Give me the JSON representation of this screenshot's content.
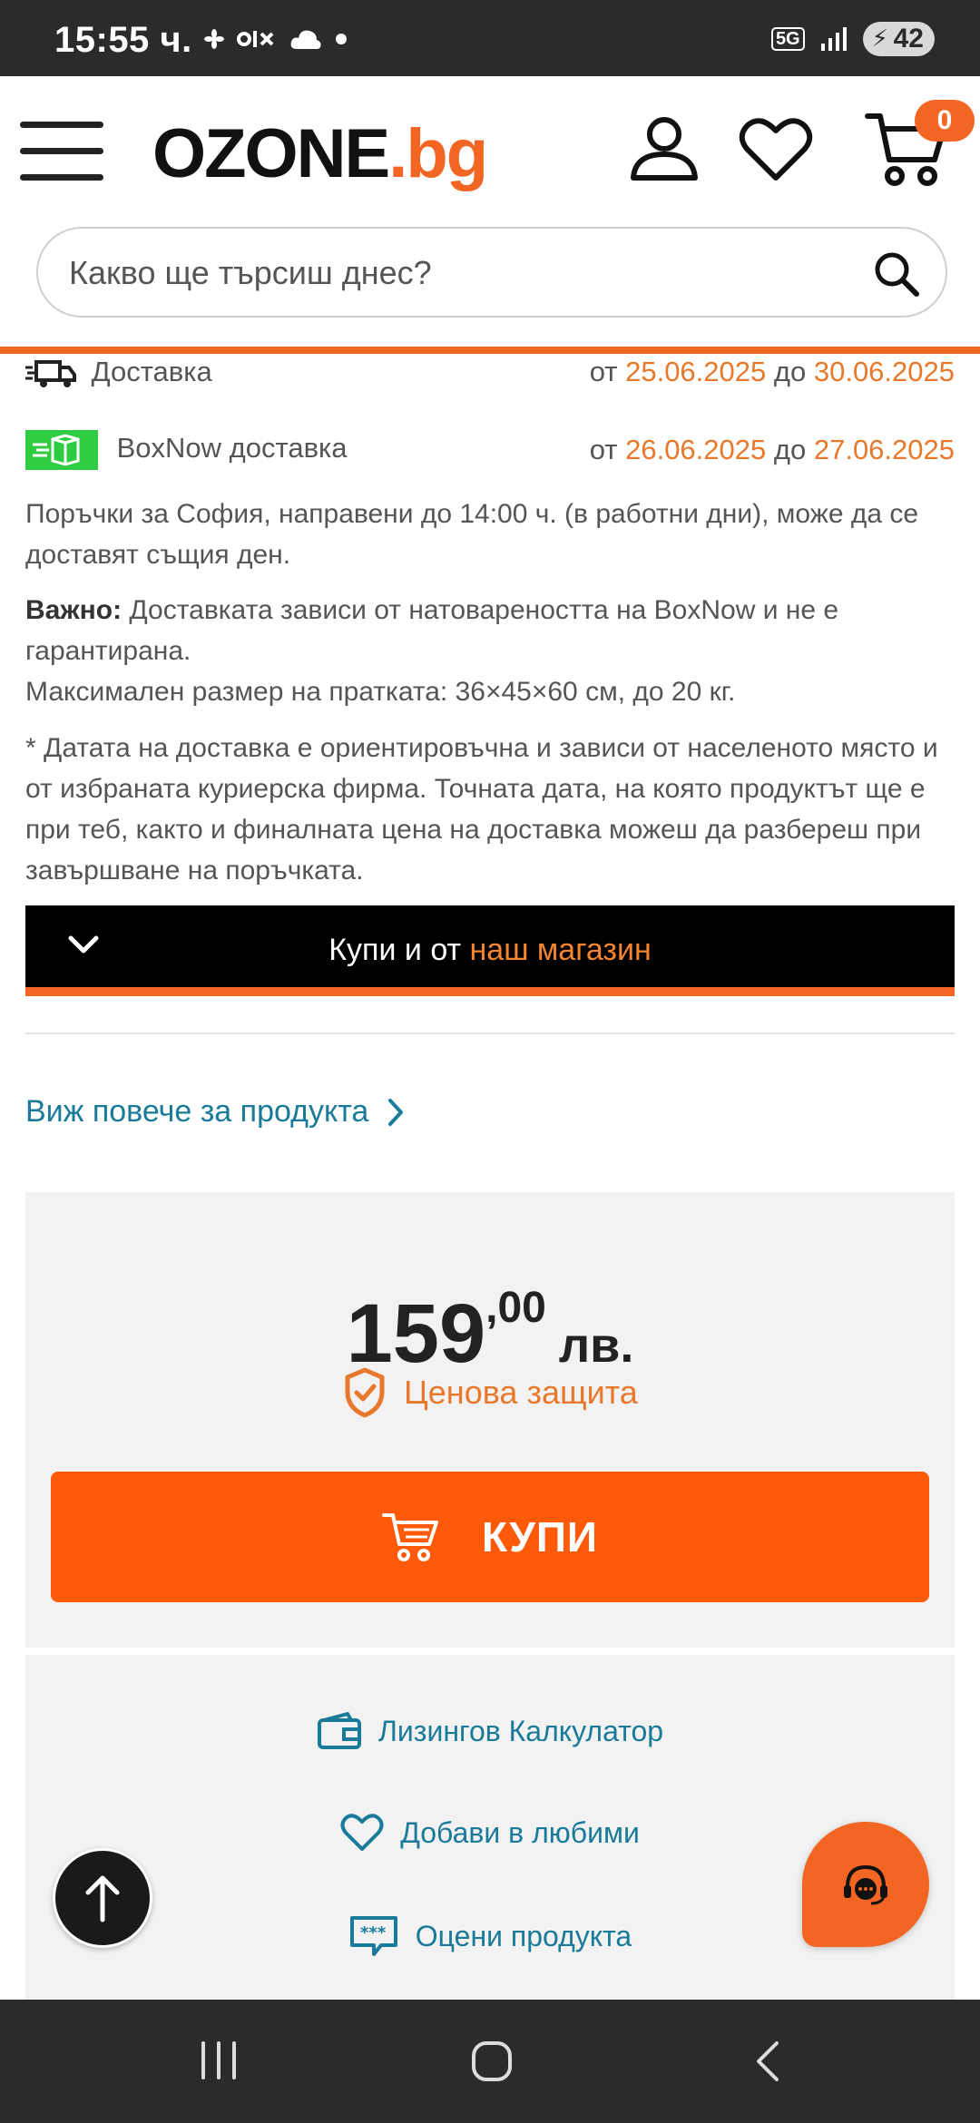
{
  "status_bar": {
    "time": "15:55 ч.",
    "network": "5G",
    "battery": "42",
    "notification_icons": [
      "fan-icon",
      "olx-icon",
      "cloud-icon",
      "dot-icon"
    ]
  },
  "header": {
    "logo_main": "OZONE",
    "logo_suffix": "bg",
    "cart_count": "0",
    "search_placeholder": "Какво ще търсиш днес?"
  },
  "delivery": {
    "courier": {
      "label": "Доставка",
      "from_word": "от",
      "from_date": "25.06.2025",
      "to_word": "до",
      "to_date": "30.06.2025"
    },
    "boxnow": {
      "label": "BoxNow доставка",
      "from_word": "от",
      "from_date": "26.06.2025",
      "to_word": "до",
      "to_date": "27.06.2025"
    },
    "sofia_note": "Поръчки за София, направени до 14:00 ч. (в работни дни), може да се доставят същия ден.",
    "important_label": "Важно:",
    "important_text": " Доставката зависи от натовареността на BoxNow и не е гарантирана.",
    "max_size": "Максимален размер на пратката: 36×45×60 см, до 20 кг.",
    "disclaimer": "* Датата на доставка е ориентировъчна и зависи от населеното място и от избраната куриерска фирма. Точната дата, на която продуктът ще е при теб, както и финалната цена на доставка можеш да разбереш при завършване на поръчката."
  },
  "store_bar": {
    "text_prefix": "Купи и от ",
    "text_highlight": "наш магазин"
  },
  "more_link": "Виж повече за продукта",
  "price": {
    "integer": "159",
    "decimal": ",00",
    "currency": "лв.",
    "protection": "Ценова защита"
  },
  "buy_button": "КУПИ",
  "links": {
    "leasing": "Лизингов Калкулатор",
    "favorites": "Добави в любими",
    "rate": "Оцени продукта"
  },
  "colors": {
    "brand_orange": "#f26522",
    "buy_orange": "#ff5a0a",
    "link_teal": "#1a7a99",
    "boxnow_green": "#2ecc40"
  }
}
